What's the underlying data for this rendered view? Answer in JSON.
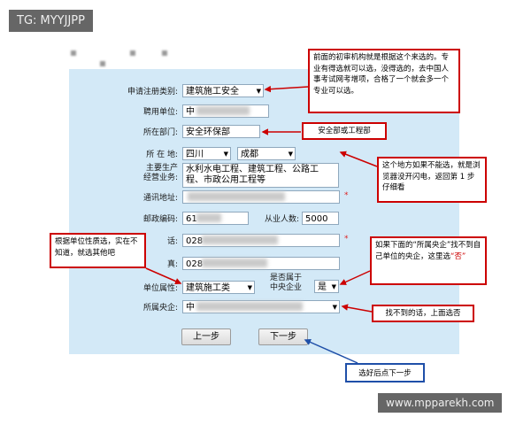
{
  "watermark_top": "TG: MYYJJPP",
  "watermark_bottom": "www.mpparekh.com",
  "form": {
    "category_label": "申请注册类别:",
    "category_value": "建筑施工安全",
    "employer_label": "聘用单位:",
    "employer_value": "中",
    "dept_label": "所在部门:",
    "dept_value": "安全环保部",
    "location_label": "所 在 地:",
    "province": "四川",
    "city": "成都",
    "business_label_1": "主要生产",
    "business_label_2": "经营业务:",
    "business_value": "水利水电工程、建筑工程、公路工程、市政公用工程等",
    "address_label": "通讯地址:",
    "address_value": "",
    "postcode_label": "邮政编码:",
    "postcode_value": "61",
    "staff_label": "从业人数:",
    "staff_value": "5000",
    "phone_label_tail": "话:",
    "phone_value": "028",
    "fax_label_tail": "真:",
    "fax_value": "028",
    "property_label": "单位属性:",
    "property_value": "建筑施工类",
    "central_q_1": "是否属于",
    "central_q_2": "中央企业",
    "central_q_value": "是",
    "central_label": "所属央企:",
    "central_value": "中",
    "required_mark": "*"
  },
  "buttons": {
    "prev": "上一步",
    "next": "下一步"
  },
  "callouts": {
    "top": "前面的初审机构就是根据这个来选的。专业有得选就可以选，没得选的，去中国人事考试网考增项，合格了一个就会多一个专业可以选。",
    "dept": "安全部或工程部",
    "location": "这个地方如果不能选，就是浏览器没开闪电，返回第 1 步仔细看",
    "property": "根据单位性质选，实在不知道，就选其他吧",
    "central_1": "如果下面的“所属央企”找不到自己单位的央企，这里选",
    "central_highlight": "“否”",
    "not_found": "找不到的话，上面选否",
    "next_hint": "选好后点下一步"
  },
  "colors": {
    "panel": "#d3e9f7",
    "callout_red": "#cc0000",
    "callout_blue": "#1f4fa8"
  }
}
